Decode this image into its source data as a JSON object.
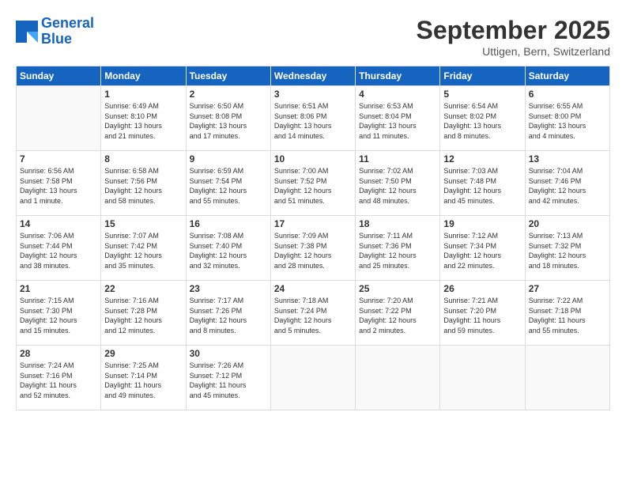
{
  "header": {
    "logo_line1": "General",
    "logo_line2": "Blue",
    "month": "September 2025",
    "location": "Uttigen, Bern, Switzerland"
  },
  "days_of_week": [
    "Sunday",
    "Monday",
    "Tuesday",
    "Wednesday",
    "Thursday",
    "Friday",
    "Saturday"
  ],
  "weeks": [
    [
      {
        "num": "",
        "info": ""
      },
      {
        "num": "1",
        "info": "Sunrise: 6:49 AM\nSunset: 8:10 PM\nDaylight: 13 hours\nand 21 minutes."
      },
      {
        "num": "2",
        "info": "Sunrise: 6:50 AM\nSunset: 8:08 PM\nDaylight: 13 hours\nand 17 minutes."
      },
      {
        "num": "3",
        "info": "Sunrise: 6:51 AM\nSunset: 8:06 PM\nDaylight: 13 hours\nand 14 minutes."
      },
      {
        "num": "4",
        "info": "Sunrise: 6:53 AM\nSunset: 8:04 PM\nDaylight: 13 hours\nand 11 minutes."
      },
      {
        "num": "5",
        "info": "Sunrise: 6:54 AM\nSunset: 8:02 PM\nDaylight: 13 hours\nand 8 minutes."
      },
      {
        "num": "6",
        "info": "Sunrise: 6:55 AM\nSunset: 8:00 PM\nDaylight: 13 hours\nand 4 minutes."
      }
    ],
    [
      {
        "num": "7",
        "info": "Sunrise: 6:56 AM\nSunset: 7:58 PM\nDaylight: 13 hours\nand 1 minute."
      },
      {
        "num": "8",
        "info": "Sunrise: 6:58 AM\nSunset: 7:56 PM\nDaylight: 12 hours\nand 58 minutes."
      },
      {
        "num": "9",
        "info": "Sunrise: 6:59 AM\nSunset: 7:54 PM\nDaylight: 12 hours\nand 55 minutes."
      },
      {
        "num": "10",
        "info": "Sunrise: 7:00 AM\nSunset: 7:52 PM\nDaylight: 12 hours\nand 51 minutes."
      },
      {
        "num": "11",
        "info": "Sunrise: 7:02 AM\nSunset: 7:50 PM\nDaylight: 12 hours\nand 48 minutes."
      },
      {
        "num": "12",
        "info": "Sunrise: 7:03 AM\nSunset: 7:48 PM\nDaylight: 12 hours\nand 45 minutes."
      },
      {
        "num": "13",
        "info": "Sunrise: 7:04 AM\nSunset: 7:46 PM\nDaylight: 12 hours\nand 42 minutes."
      }
    ],
    [
      {
        "num": "14",
        "info": "Sunrise: 7:06 AM\nSunset: 7:44 PM\nDaylight: 12 hours\nand 38 minutes."
      },
      {
        "num": "15",
        "info": "Sunrise: 7:07 AM\nSunset: 7:42 PM\nDaylight: 12 hours\nand 35 minutes."
      },
      {
        "num": "16",
        "info": "Sunrise: 7:08 AM\nSunset: 7:40 PM\nDaylight: 12 hours\nand 32 minutes."
      },
      {
        "num": "17",
        "info": "Sunrise: 7:09 AM\nSunset: 7:38 PM\nDaylight: 12 hours\nand 28 minutes."
      },
      {
        "num": "18",
        "info": "Sunrise: 7:11 AM\nSunset: 7:36 PM\nDaylight: 12 hours\nand 25 minutes."
      },
      {
        "num": "19",
        "info": "Sunrise: 7:12 AM\nSunset: 7:34 PM\nDaylight: 12 hours\nand 22 minutes."
      },
      {
        "num": "20",
        "info": "Sunrise: 7:13 AM\nSunset: 7:32 PM\nDaylight: 12 hours\nand 18 minutes."
      }
    ],
    [
      {
        "num": "21",
        "info": "Sunrise: 7:15 AM\nSunset: 7:30 PM\nDaylight: 12 hours\nand 15 minutes."
      },
      {
        "num": "22",
        "info": "Sunrise: 7:16 AM\nSunset: 7:28 PM\nDaylight: 12 hours\nand 12 minutes."
      },
      {
        "num": "23",
        "info": "Sunrise: 7:17 AM\nSunset: 7:26 PM\nDaylight: 12 hours\nand 8 minutes."
      },
      {
        "num": "24",
        "info": "Sunrise: 7:18 AM\nSunset: 7:24 PM\nDaylight: 12 hours\nand 5 minutes."
      },
      {
        "num": "25",
        "info": "Sunrise: 7:20 AM\nSunset: 7:22 PM\nDaylight: 12 hours\nand 2 minutes."
      },
      {
        "num": "26",
        "info": "Sunrise: 7:21 AM\nSunset: 7:20 PM\nDaylight: 11 hours\nand 59 minutes."
      },
      {
        "num": "27",
        "info": "Sunrise: 7:22 AM\nSunset: 7:18 PM\nDaylight: 11 hours\nand 55 minutes."
      }
    ],
    [
      {
        "num": "28",
        "info": "Sunrise: 7:24 AM\nSunset: 7:16 PM\nDaylight: 11 hours\nand 52 minutes."
      },
      {
        "num": "29",
        "info": "Sunrise: 7:25 AM\nSunset: 7:14 PM\nDaylight: 11 hours\nand 49 minutes."
      },
      {
        "num": "30",
        "info": "Sunrise: 7:26 AM\nSunset: 7:12 PM\nDaylight: 11 hours\nand 45 minutes."
      },
      {
        "num": "",
        "info": ""
      },
      {
        "num": "",
        "info": ""
      },
      {
        "num": "",
        "info": ""
      },
      {
        "num": "",
        "info": ""
      }
    ]
  ]
}
